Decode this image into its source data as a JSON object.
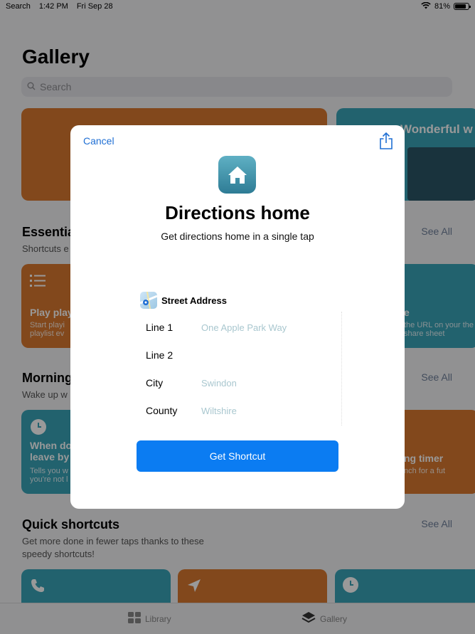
{
  "status_bar": {
    "back_label": "Search",
    "time": "1:42 PM",
    "date": "Fri Sep 28",
    "battery": "81%"
  },
  "gallery": {
    "title": "Gallery",
    "search_placeholder": "Search",
    "hero_right_text": "Wonderful w",
    "sections": [
      {
        "title": "Essentia",
        "subtitle": "Shortcuts e",
        "see_all": "See All",
        "card_left_title": "Play play",
        "card_left_sub": "Start playi playlist ev",
        "card_right_title": "e",
        "card_right_sub": "the URL on your the share sheet"
      },
      {
        "title": "Morning",
        "subtitle": "Wake up w",
        "see_all": "See All",
        "card_left_title": "When do leave by",
        "card_left_sub": "Tells you w you're not l",
        "card_right_title": "ng timer",
        "card_right_sub": "nch for a fut"
      },
      {
        "title": "Quick shortcuts",
        "subtitle": "Get more done in fewer taps thanks to these speedy shortcuts!",
        "see_all": "See All"
      }
    ],
    "tabs": [
      {
        "label": "Library"
      },
      {
        "label": "Gallery"
      }
    ]
  },
  "modal": {
    "cancel_label": "Cancel",
    "share_icon": "share-icon",
    "app_icon": "house-icon",
    "title": "Directions home",
    "subtitle": "Get directions home in a single tap",
    "form": {
      "header": "Street Address",
      "fields": [
        {
          "label": "Line 1",
          "value": "One Apple Park Way"
        },
        {
          "label": "Line 2",
          "value": ""
        },
        {
          "label": "City",
          "value": "Swindon"
        },
        {
          "label": "County",
          "value": "Wiltshire"
        }
      ]
    },
    "button_label": "Get Shortcut"
  },
  "colors": {
    "accent": "#0b7cf2",
    "link": "#1f6fd4",
    "card_orange": "#d9782f",
    "card_teal": "#3aa3b8"
  }
}
